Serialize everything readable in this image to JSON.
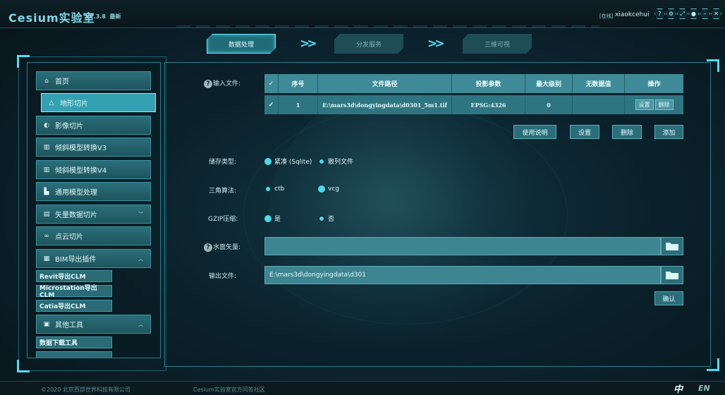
{
  "app": {
    "title": "Cesium实验室",
    "version": "V2.3.8",
    "version_tag": "最新",
    "status_prefix": "[在线]",
    "username": "xiaokcehui"
  },
  "titlebar_icons": [
    "help-icon",
    "settings-icon",
    "expand-icon",
    "user-icon",
    "minimize-icon",
    "close-icon"
  ],
  "steps": [
    {
      "label": "数据处理",
      "active": true
    },
    {
      "label": "分发服务",
      "active": false
    },
    {
      "label": "三维可视",
      "active": false
    }
  ],
  "sidebar": {
    "items": [
      {
        "label": "首页",
        "icon": "home-icon"
      },
      {
        "label": "地形切片",
        "icon": "terrain-icon",
        "selected": true
      },
      {
        "label": "影像切片",
        "icon": "globe-icon"
      },
      {
        "label": "倾斜模型转换V3",
        "icon": "building-icon"
      },
      {
        "label": "倾斜模型转换V4",
        "icon": "building-icon"
      },
      {
        "label": "通用模型处理",
        "icon": "cube-icon"
      },
      {
        "label": "矢量数据切片",
        "icon": "map-icon",
        "expandable": true
      },
      {
        "label": "点云切片",
        "icon": "pointcloud-icon"
      },
      {
        "label": "BIM导出插件",
        "icon": "bim-icon",
        "expanded": true
      },
      {
        "label": "其他工具",
        "icon": "toolbox-icon",
        "expanded": true
      }
    ],
    "bim_sub": [
      "Revit导出CLM",
      "Microstation导出CLM",
      "Catia导出CLM"
    ],
    "tools_sub": [
      "数据下载工具",
      "..."
    ]
  },
  "form": {
    "input_files_label": "输入文件:",
    "table": {
      "columns": [
        "序号",
        "文件路径",
        "投影参数",
        "最大级别",
        "无数据值",
        "操作"
      ],
      "rows": [
        {
          "index": "1",
          "path": "E:\\mars3d\\dongyingdata\\d0301_5m1.tif",
          "projection": "EPSG:4326",
          "max_level": "0",
          "nodata": "",
          "actions": [
            "设置",
            "删除"
          ]
        }
      ]
    },
    "table_buttons": [
      "使用说明",
      "设置",
      "删除",
      "添加"
    ],
    "storage": {
      "label": "储存类型:",
      "options": [
        "紧凑 (Sqlite)",
        "散列文件"
      ],
      "selected": 0
    },
    "triangulation": {
      "label": "三角算法:",
      "options": [
        "ctb",
        "vcg"
      ],
      "selected": 1
    },
    "gzip": {
      "label": "GZIP压缩:",
      "options": [
        "是",
        "否"
      ],
      "selected": 0
    },
    "water_label": "水面矢量:",
    "water_value": "",
    "output_label": "输出文件:",
    "output_value": "E:\\mars3d\\dongyingdata\\d301",
    "confirm_label": "确认"
  },
  "footer": {
    "copyright": "©2020 北京西部世界科技有限公司",
    "community": "Cesium实验室官方问答社区",
    "lang_zh": "中",
    "lang_en": "EN"
  }
}
